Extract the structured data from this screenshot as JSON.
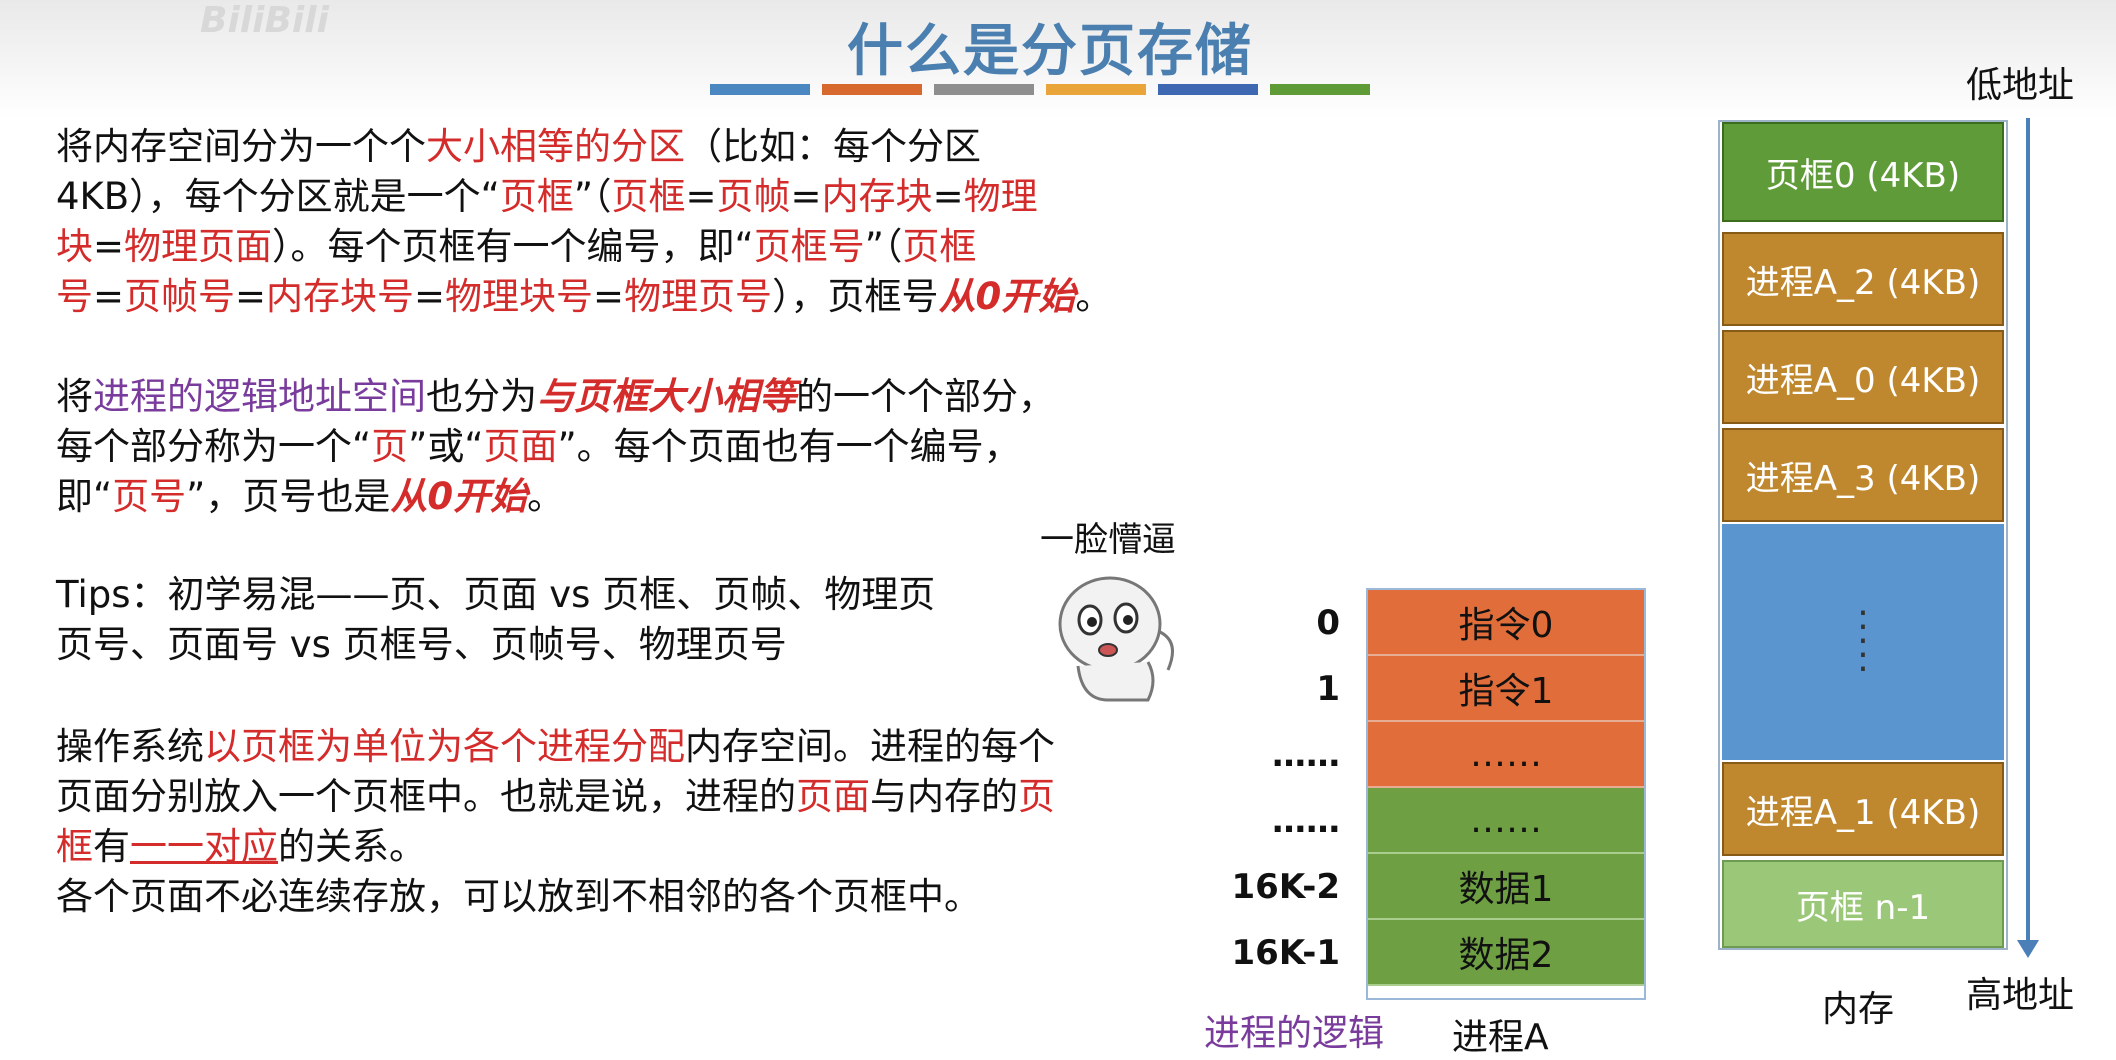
{
  "title": "什么是分页存储",
  "watermark": "BiliBili",
  "color_bars": [
    "#4a86c0",
    "#d7692e",
    "#8e8e8e",
    "#e9a43a",
    "#3e68b1",
    "#5e9a35"
  ],
  "p1": {
    "l1a": "将内存空间分为一个个",
    "l1b": "大小相等的分区",
    "l1c": "（比如：每个分区",
    "l2a": "4KB），每个分区就是一个“",
    "l2b": "页框",
    "l2c": "”（",
    "l2d": "页框",
    "l2e": "=",
    "l2f": "页帧",
    "l2g": "=",
    "l2h": "内存块",
    "l2i": "=",
    "l2j": "物理",
    "l3a": "块",
    "l3b": "=",
    "l3c": "物理页面",
    "l3d": "）。每个页框有一个编号，即“",
    "l3e": "页框号",
    "l3f": "”（",
    "l3g": "页框",
    "l4a": "号",
    "l4b": "=",
    "l4c": "页帧号",
    "l4d": "=",
    "l4e": "内存块号",
    "l4f": "=",
    "l4g": "物理块号",
    "l4h": "=",
    "l4i": "物理页号",
    "l4j": "），页框号",
    "l4k": "从0开始",
    "l4l": "。"
  },
  "p2": {
    "l1a": "将",
    "l1b": "进程的逻辑地址空间",
    "l1c": "也分为",
    "l1d": "与页框大小相等",
    "l1e": "的一个个部分，",
    "l2a": "每个部分称为一个“",
    "l2b": "页",
    "l2c": "”或“",
    "l2d": "页面",
    "l2e": "”。每个页面也有一个编号，",
    "l3a": "即“",
    "l3b": "页号",
    "l3c": "”，页号也是",
    "l3d": "从0开始",
    "l3e": "。"
  },
  "tips": {
    "l1": "Tips：初学易混——页、页面 vs 页框、页帧、物理页",
    "l2": "页号、页面号 vs 页框号、页帧号、物理页号"
  },
  "p3": {
    "l1a": "操作系统",
    "l1b": "以页框为单位为各个进程分配",
    "l1c": "内存空间。进程的每个",
    "l2a": "页面分别放入一个页框中。也就是说，进程的",
    "l2b": "页面",
    "l2c": "与内存的",
    "l2d": "页",
    "l3a": "框",
    "l3b": "有",
    "l3c": "一一对应",
    "l3d": "的关系。",
    "l4": "各个页面不必连续存放，可以放到不相邻的各个页框中。"
  },
  "emoji_label": "一脸懵逼",
  "logic": {
    "addresses": [
      "0",
      "1",
      "……",
      "……",
      "16K-2",
      "16K-1"
    ],
    "cells": [
      "指令0",
      "指令1",
      "……",
      "……",
      "数据1",
      "数据2"
    ],
    "caption_left": "进程的逻辑",
    "caption_right": "进程A"
  },
  "memory": {
    "low_label": "低地址",
    "high_label": "高地址",
    "caption": "内存",
    "blocks": [
      "页框0 (4KB)",
      "进程A_2 (4KB)",
      "进程A_0 (4KB)",
      "进程A_3 (4KB)",
      "",
      "进程A_1 (4KB)",
      "页框 n-1"
    ]
  }
}
